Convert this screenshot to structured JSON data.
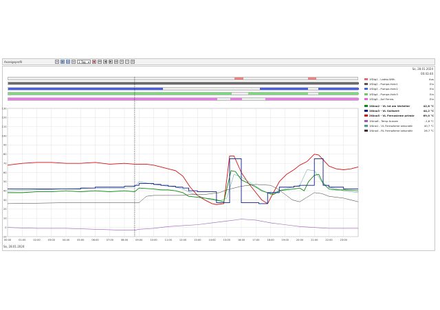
{
  "toolbar": {
    "profile": "Anzeigeprofil",
    "range_select": "1 Tag",
    "buttons": [
      "list-icon",
      "table-icon",
      "grid-icon",
      "fit-icon",
      "chart-icon",
      "calendar-icon",
      "step-back-icon",
      "prev-icon",
      "next-icon",
      "step-forward-icon",
      "zoom-in-icon",
      "zoom-out-icon",
      "zoom-reset-icon"
    ]
  },
  "header": {
    "date": "So, 28.01.2024",
    "time": "00:43:44"
  },
  "digital_legend": [
    {
      "name": "1fDig1 - Ladep.Witt.",
      "value": "Aus",
      "color": "#e36a6a"
    },
    {
      "name": "1fDig2 - Pumpe-Hzkr1",
      "value": "Ein",
      "color": "#555555"
    },
    {
      "name": "1fDig3 - Pumpe-Hzkr2",
      "value": "Ein",
      "color": "#4466dd"
    },
    {
      "name": "1fDig4 - Pumpe-Hzkr3",
      "value": "Ein",
      "color": "#66cc66"
    },
    {
      "name": "1fDig5 - Anf Fernw.",
      "value": "Ein",
      "color": "#dd66dd"
    }
  ],
  "analog_legend": [
    {
      "name": "1fAna2 - VL Ist am Verteiler",
      "value": "42,8 °C",
      "color": "#0a8a0a",
      "bold": true
    },
    {
      "name": "1fAna3 - VL Sollwert",
      "value": "44,2 °C",
      "color": "#0a1a8a",
      "bold": true
    },
    {
      "name": "2fAna5 - VL Fernwärme primär",
      "value": "69,0 °C",
      "color": "#d41010",
      "bold": true
    },
    {
      "name": "1fAna6 - Temp Aussen",
      "value": "-1,6 °C",
      "color": "#9b59b6",
      "bold": false
    },
    {
      "name": "1fAna1 - VL Fernwärme sekundär",
      "value": "40,7 °C",
      "color": "#4a9a9a",
      "bold": false
    },
    {
      "name": "1fAna4 - RL Fernwärme sekundär",
      "value": "26,7 °C",
      "color": "#333333",
      "bold": false
    }
  ],
  "digital_tracks": [
    {
      "color": "#f08080",
      "segments": [
        [
          15.5,
          16.1
        ],
        [
          20.5,
          21.1
        ]
      ]
    },
    {
      "color": "#6a6a6a",
      "segments": [
        [
          0,
          24
        ]
      ]
    },
    {
      "color": "#4a5fe0",
      "segments": [
        [
          0,
          10.6
        ],
        [
          17.2,
          20.5
        ],
        [
          21.2,
          24
        ]
      ]
    },
    {
      "color": "#7cd87c",
      "segments": [
        [
          0,
          15.3
        ],
        [
          16.4,
          20.5
        ],
        [
          21.2,
          24
        ]
      ]
    },
    {
      "color": "#e77ae7",
      "segments": [
        [
          0,
          14.3
        ],
        [
          15.2,
          16.0
        ],
        [
          17.6,
          24
        ]
      ]
    }
  ],
  "footer_date": "So, 28.01.2024",
  "chart_data": {
    "type": "line",
    "x_unit": "hours",
    "xlim": [
      0,
      24
    ],
    "ylim": [
      -10,
      130
    ],
    "y_ticks": [
      130,
      120,
      110,
      100,
      90,
      80,
      70,
      60,
      50,
      40,
      30,
      20,
      10,
      0,
      -10
    ],
    "x_ticks": [
      "00:00",
      "01:00",
      "02:00",
      "03:00",
      "04:00",
      "05:00",
      "06:00",
      "07:00",
      "08:00",
      "09:00",
      "10:00",
      "11:00",
      "12:00",
      "13:00",
      "14:00",
      "15:00",
      "16:00",
      "17:00",
      "18:00",
      "19:00",
      "20:00",
      "21:00",
      "22:00",
      "23:00"
    ],
    "cursor_x": 8.7,
    "grid": true,
    "series": [
      {
        "name": "2fAna5 - VL Fernwärme primär",
        "color": "#d41010",
        "width": 0.9,
        "x": [
          0,
          1,
          2,
          3,
          4,
          5,
          6,
          7,
          8,
          8.7,
          9.5,
          10,
          10.5,
          11,
          11.5,
          12,
          12.5,
          13,
          13.5,
          14,
          14.3,
          14.8,
          15.2,
          15.5,
          16,
          16.5,
          17,
          17.4,
          17.8,
          18.2,
          18.6,
          19.1,
          19.6,
          20,
          20.5,
          21,
          21.3,
          21.6,
          22,
          22.5,
          23,
          23.5,
          24
        ],
        "y": [
          68,
          70,
          71,
          71,
          70,
          70,
          71,
          69,
          70,
          69,
          69,
          68,
          66,
          64,
          62,
          56,
          44,
          35,
          30,
          26,
          25,
          26,
          78,
          78,
          60,
          48,
          38,
          30,
          26,
          38,
          50,
          58,
          63,
          68,
          72,
          80,
          79,
          74,
          67,
          64,
          63,
          64,
          66
        ]
      },
      {
        "name": "1fAna1 - VL Fernwärme sekundär",
        "color": "#4a9a9a",
        "width": 0.5,
        "x": [
          0,
          2,
          4,
          6,
          8,
          8.7,
          9,
          10,
          10.5,
          11,
          11.5,
          12,
          12.5,
          13,
          13.5,
          14,
          14.5,
          15,
          15.5,
          16,
          16.5,
          17,
          17.5,
          18,
          18.5,
          19,
          19.5,
          20,
          20.5,
          21,
          21.5,
          22,
          23,
          24
        ],
        "y": [
          40,
          41,
          42,
          43,
          43,
          44,
          50,
          47,
          46,
          45,
          44,
          42,
          38,
          35,
          32,
          30,
          29,
          32,
          58,
          55,
          50,
          45,
          40,
          36,
          40,
          42,
          44,
          46,
          63,
          62,
          50,
          44,
          40,
          38
        ]
      },
      {
        "name": "1fAna2 - VL Ist am Verteiler",
        "color": "#0a8a0a",
        "width": 0.9,
        "x": [
          0,
          1,
          2,
          3,
          4,
          5,
          6,
          7,
          8,
          8.7,
          9,
          10,
          10.5,
          11,
          11.5,
          12,
          12.4,
          13,
          13.5,
          14,
          14.3,
          14.8,
          15.3,
          15.6,
          16,
          16.5,
          17,
          17.4,
          17.8,
          18.2,
          18.6,
          19,
          19.6,
          20,
          20.3,
          20.6,
          21,
          21.3,
          21.6,
          22,
          22.5,
          23,
          24
        ],
        "y": [
          38,
          38,
          39,
          39,
          40,
          39,
          40,
          39,
          40,
          39,
          43,
          42,
          41,
          41,
          40,
          38,
          34,
          33,
          32,
          31,
          30,
          28,
          62,
          61,
          52,
          48,
          44,
          40,
          38,
          36,
          40,
          41,
          42,
          43,
          40,
          50,
          57,
          58,
          48,
          42,
          41,
          41,
          40
        ]
      },
      {
        "name": "1fAna3 - VL Sollwert",
        "color": "#0a1a8a",
        "width": 0.9,
        "step": true,
        "x": [
          0,
          3,
          5,
          6,
          8,
          8.7,
          9,
          10,
          10.5,
          11,
          11.5,
          12,
          12.4,
          13,
          14,
          14.3,
          14.7,
          15.2,
          15.6,
          16,
          17.2,
          17.8,
          18.6,
          19.1,
          19.6,
          20,
          20.5,
          21,
          21.2,
          21.6,
          22,
          23,
          24
        ],
        "y": [
          42,
          42,
          43,
          44,
          45,
          46,
          48,
          47,
          46,
          45,
          44,
          43,
          40,
          39,
          39,
          27,
          27,
          75,
          75,
          27,
          26,
          38,
          44,
          44,
          45,
          46,
          46,
          75,
          75,
          46,
          44,
          42,
          42
        ]
      },
      {
        "name": "1fAna4 - RL Fernwärme sekundär",
        "color": "#333333",
        "width": 0.5,
        "x": [
          0,
          4,
          8,
          8.7,
          9,
          9.5,
          10,
          11,
          12,
          12.5,
          13,
          13.5,
          14,
          14.5,
          15,
          16,
          17,
          18,
          18.5,
          19,
          19.5,
          20,
          20.5,
          21,
          21.5,
          22,
          23,
          24
        ],
        "y": [
          26,
          27,
          27,
          27,
          27,
          34,
          35,
          35,
          35,
          36,
          36,
          36,
          37,
          38,
          41,
          45,
          47,
          46,
          42,
          36,
          30,
          28,
          33,
          38,
          37,
          34,
          32,
          28
        ]
      },
      {
        "name": "1fAna6 - Temp Aussen",
        "color": "#9b59b6",
        "width": 0.6,
        "x": [
          0,
          2,
          4,
          6,
          8,
          8.7,
          9,
          10,
          11,
          12,
          13,
          14,
          15,
          16,
          17,
          18,
          19,
          20,
          21,
          22,
          23,
          24
        ],
        "y": [
          0,
          -1,
          -1,
          -2,
          -3,
          -3,
          -2,
          -1,
          1,
          2,
          3,
          5,
          7,
          9,
          8,
          5,
          3,
          1,
          0,
          -1,
          -1,
          -1
        ]
      }
    ]
  }
}
